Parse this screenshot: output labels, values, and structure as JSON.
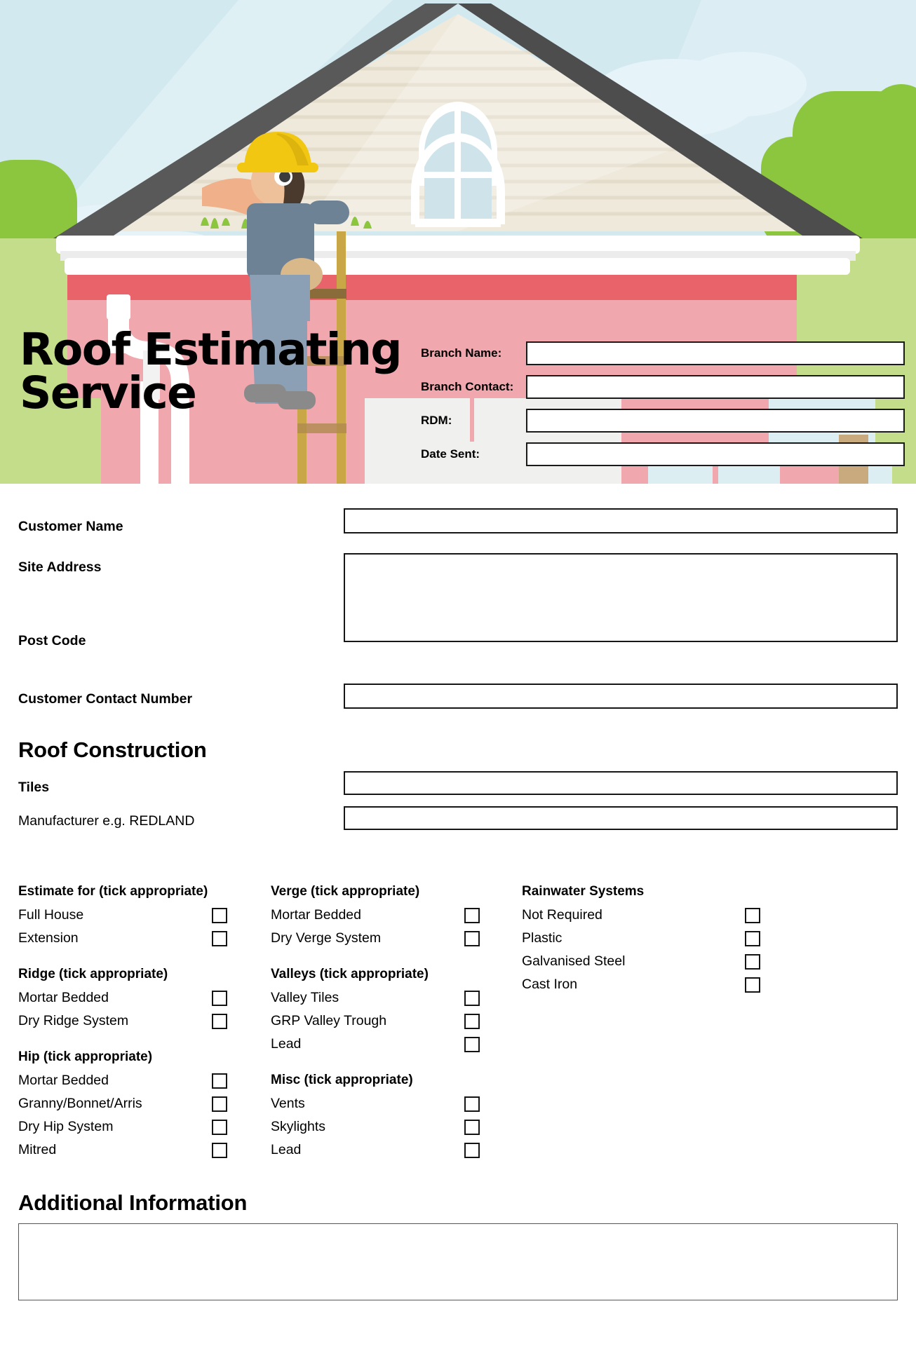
{
  "header": {
    "title_line1": "Roof Estimating",
    "title_line2": "Service",
    "illustration_name": "roofer-on-ladder-house-illustration",
    "fields": [
      {
        "label": "Branch Name:",
        "value": "",
        "name": "branch-name"
      },
      {
        "label": "Branch Contact:",
        "value": "",
        "name": "branch-contact"
      },
      {
        "label": "RDM:",
        "value": "",
        "name": "rdm"
      },
      {
        "label": "Date Sent:",
        "value": "",
        "name": "date-sent"
      }
    ]
  },
  "customer": {
    "name_label": "Customer Name",
    "name_value": "",
    "site_address_label": "Site Address",
    "site_address_value": "",
    "post_code_label": "Post Code",
    "contact_label": "Customer Contact Number",
    "contact_value": ""
  },
  "roof_construction": {
    "title": "Roof Construction",
    "tiles_label": "Tiles",
    "tiles_value": "",
    "manufacturer_label": "Manufacturer e.g. REDLAND",
    "manufacturer_value": ""
  },
  "columns": {
    "left": [
      {
        "heading": "Estimate for (tick appropriate)",
        "items": [
          {
            "label": "Full House",
            "checked": false
          },
          {
            "label": "Extension",
            "checked": false
          }
        ]
      },
      {
        "heading": "Ridge (tick appropriate)",
        "items": [
          {
            "label": "Mortar Bedded",
            "checked": false
          },
          {
            "label": "Dry Ridge System",
            "checked": false
          }
        ]
      },
      {
        "heading": "Hip (tick appropriate)",
        "items": [
          {
            "label": "Mortar Bedded",
            "checked": false
          },
          {
            "label": "Granny/Bonnet/Arris",
            "checked": false
          },
          {
            "label": "Dry Hip System",
            "checked": false
          },
          {
            "label": "Mitred",
            "checked": false
          }
        ]
      }
    ],
    "middle": [
      {
        "heading": "Verge (tick appropriate)",
        "items": [
          {
            "label": "Mortar Bedded",
            "checked": false
          },
          {
            "label": "Dry Verge System",
            "checked": false
          }
        ]
      },
      {
        "heading": "Valleys (tick appropriate)",
        "items": [
          {
            "label": "Valley Tiles",
            "checked": false
          },
          {
            "label": "GRP Valley Trough",
            "checked": false
          },
          {
            "label": "Lead",
            "checked": false
          }
        ]
      },
      {
        "heading": "Misc (tick appropriate)",
        "items": [
          {
            "label": "Vents",
            "checked": false
          },
          {
            "label": "Skylights",
            "checked": false
          },
          {
            "label": "Lead",
            "checked": false
          }
        ]
      }
    ],
    "right": [
      {
        "heading": "Rainwater Systems",
        "items": [
          {
            "label": "Not Required",
            "checked": false
          },
          {
            "label": "Plastic",
            "checked": false
          },
          {
            "label": "Galvanised Steel",
            "checked": false
          },
          {
            "label": "Cast Iron",
            "checked": false
          }
        ]
      }
    ]
  },
  "additional": {
    "title": "Additional Information",
    "value": ""
  },
  "colors": {
    "sky": "#cfe7ef",
    "cloud": "#e2f1f6",
    "roof_dark": "#4d4d4d",
    "siding": "#f1ece0",
    "wall_red": "#e8646a",
    "wall_pink": "#f0a7ad",
    "grass_green": "#8cc63f",
    "grass_light": "#c3dd8a",
    "hat_yellow": "#f2c712",
    "shirt_blue": "#6d8295",
    "jeans_blue": "#8ba0b5",
    "skin": "#f0b08a",
    "ladder": "#c9a646"
  }
}
